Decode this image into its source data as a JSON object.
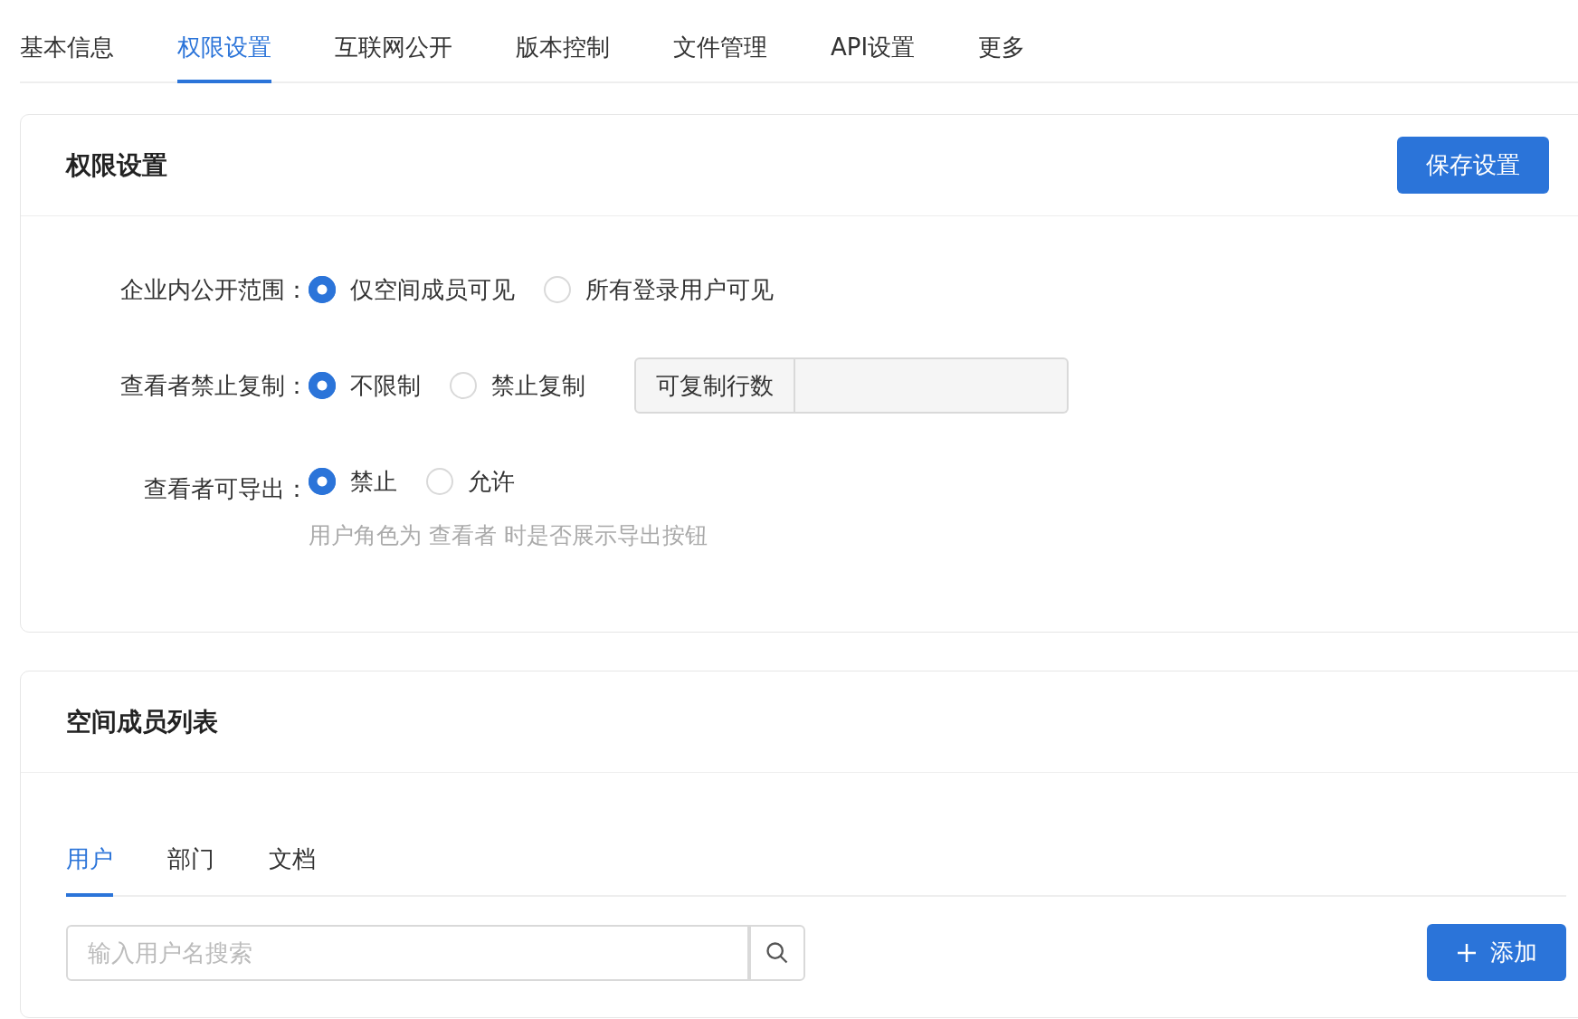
{
  "top_tabs": [
    {
      "label": "基本信息",
      "selected": false
    },
    {
      "label": "权限设置",
      "selected": true
    },
    {
      "label": "互联网公开",
      "selected": false
    },
    {
      "label": "版本控制",
      "selected": false
    },
    {
      "label": "文件管理",
      "selected": false
    },
    {
      "label": "API设置",
      "selected": false
    },
    {
      "label": "更多",
      "selected": false
    }
  ],
  "permissions": {
    "title": "权限设置",
    "save_button": "保存设置",
    "rows": [
      {
        "label": "企业内公开范围：",
        "options": [
          {
            "label": "仅空间成员可见",
            "selected": true
          },
          {
            "label": "所有登录用户可见",
            "selected": false
          }
        ]
      },
      {
        "label": "查看者禁止复制：",
        "options": [
          {
            "label": "不限制",
            "selected": true
          },
          {
            "label": "禁止复制",
            "selected": false
          }
        ],
        "input_group": {
          "addon": "可复制行数"
        }
      },
      {
        "label": "查看者可导出：",
        "options": [
          {
            "label": "禁止",
            "selected": true
          },
          {
            "label": "允许",
            "selected": false
          }
        ],
        "hint": "用户角色为 查看者 时是否展示导出按钮"
      }
    ]
  },
  "members": {
    "title": "空间成员列表",
    "tabs": [
      {
        "label": "用户",
        "selected": true
      },
      {
        "label": "部门",
        "selected": false
      },
      {
        "label": "文档",
        "selected": false
      }
    ],
    "search": {
      "placeholder": "输入用户名搜索"
    },
    "add_button": "添加"
  }
}
